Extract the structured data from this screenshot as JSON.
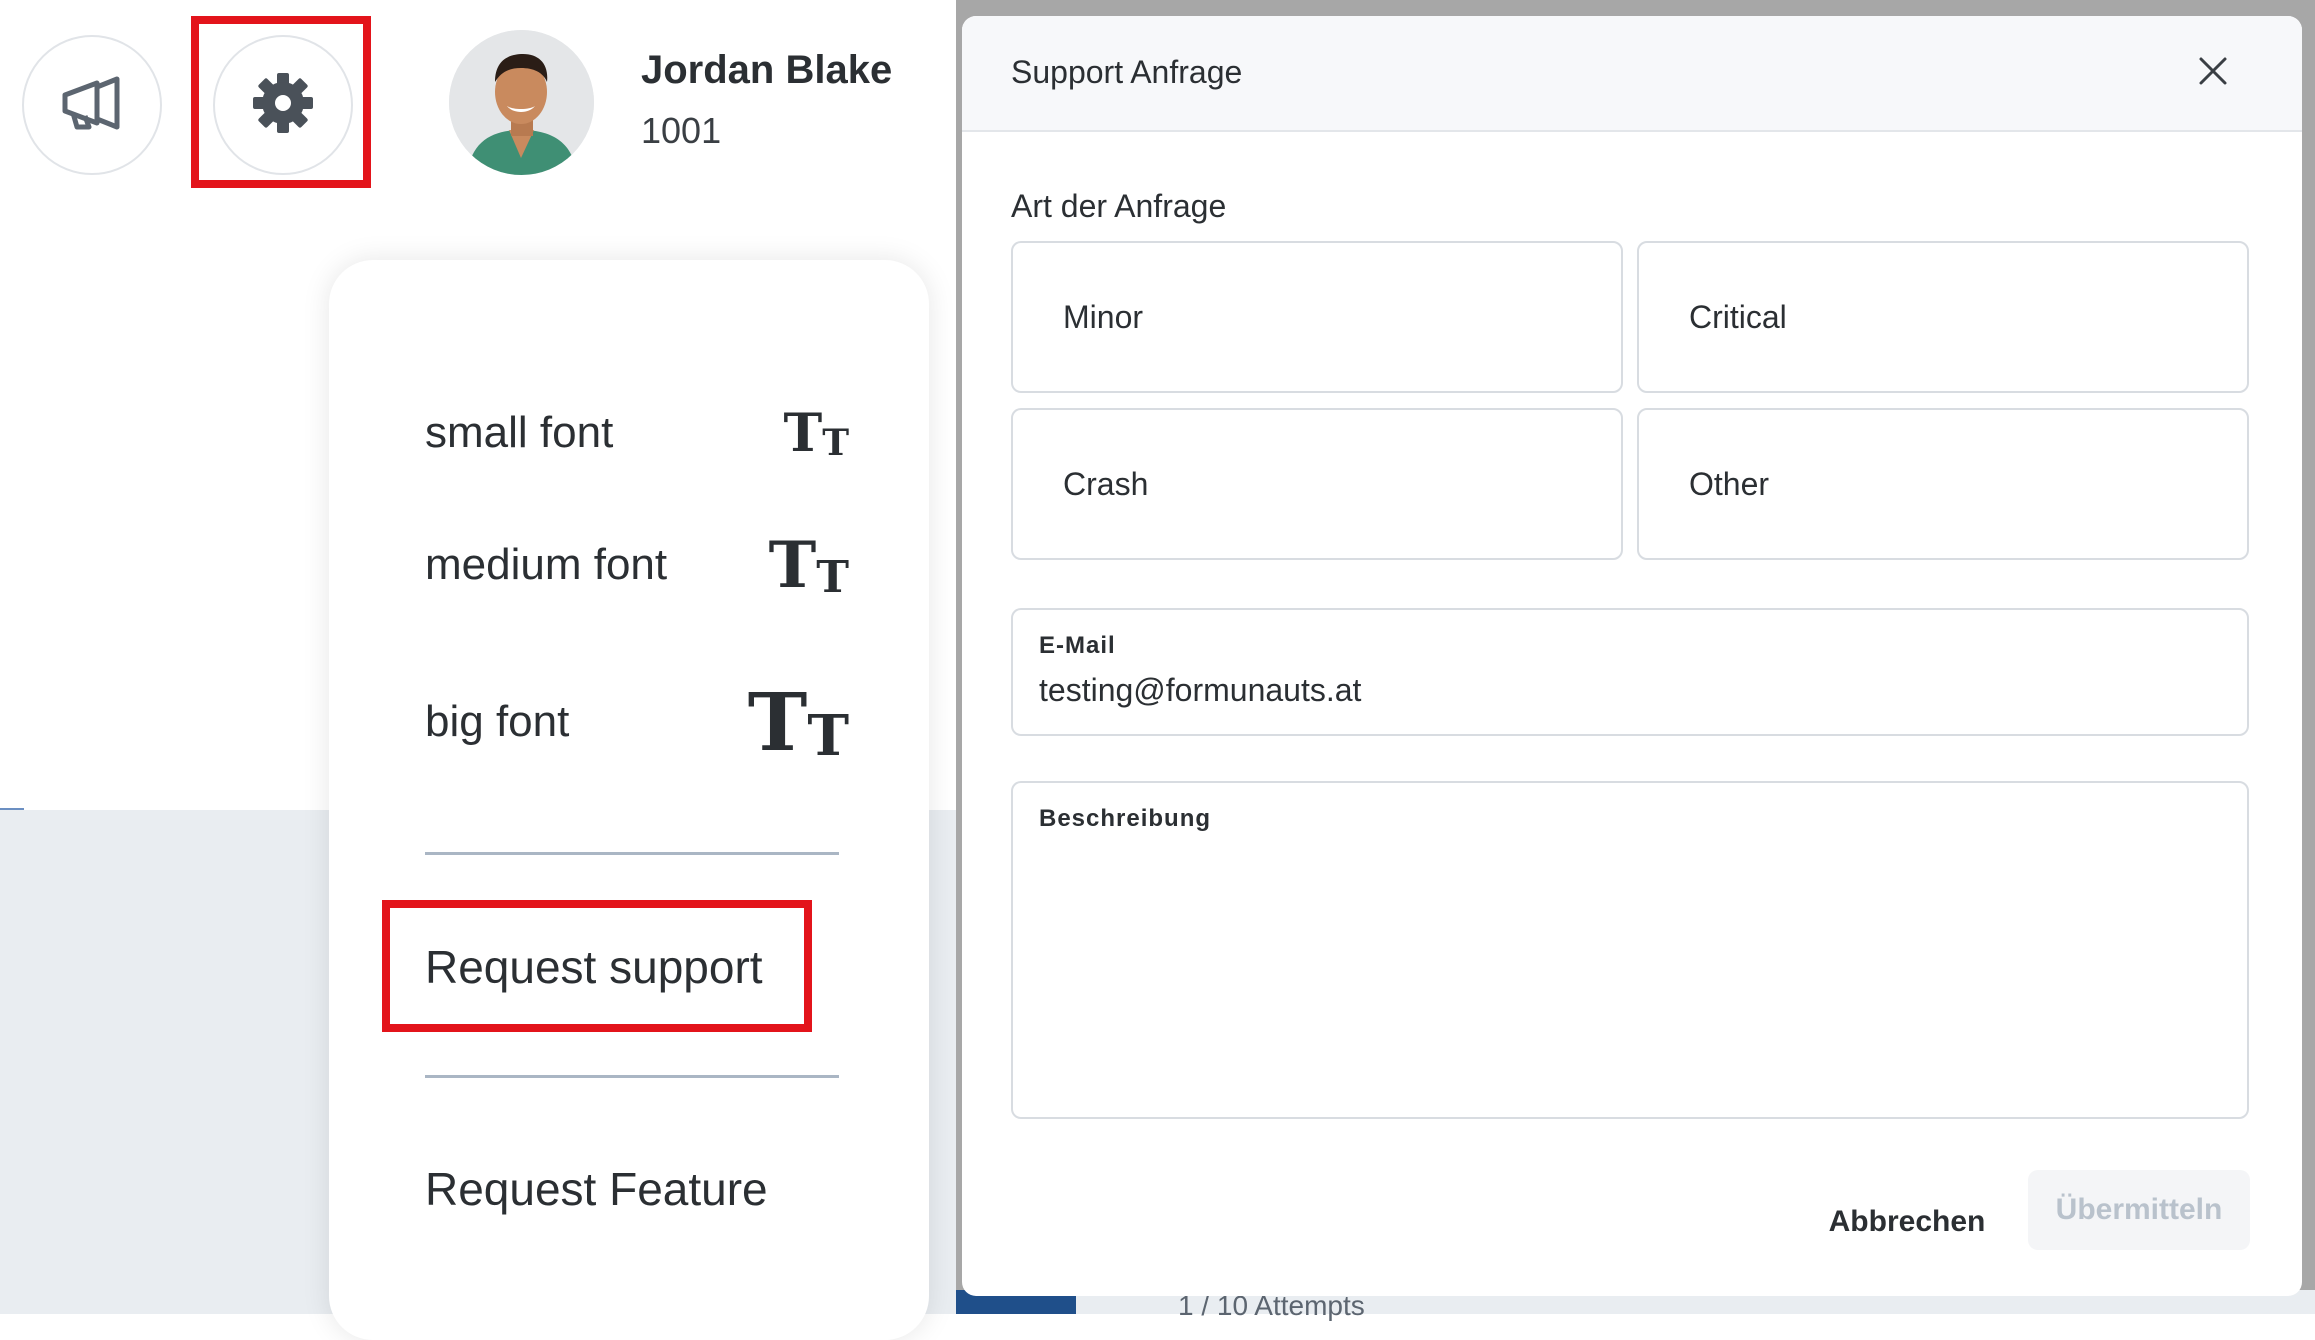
{
  "header": {
    "user_name": "Jordan Blake",
    "user_id": "1001",
    "icons": [
      "megaphone-icon",
      "gear-icon"
    ]
  },
  "menu": {
    "small_font": "small font",
    "medium_font": "medium font",
    "big_font": "big font",
    "font_icon_glyph": "TT",
    "request_support": "Request support",
    "request_feature": "Request Feature"
  },
  "modal": {
    "title": "Support Anfrage",
    "request_type_label": "Art der Anfrage",
    "types": [
      "Minor",
      "Critical",
      "Crash",
      "Other"
    ],
    "email_label": "E-Mail",
    "email_value": "testing@formunauts.at",
    "description_label": "Beschreibung",
    "description_value": "",
    "cancel_label": "Abbrechen",
    "submit_label": "Übermitteln"
  },
  "background": {
    "attempts_text": "1 / 10 Attempts"
  },
  "colors": {
    "highlight": "#e3141b",
    "text": "#2b2f33",
    "disabled_text": "#b9c2cc",
    "overlay": "#a7a7a7"
  }
}
